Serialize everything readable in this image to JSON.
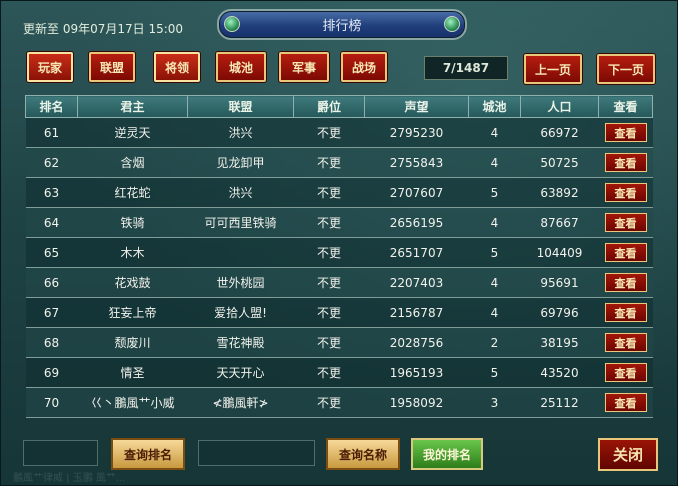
{
  "header": {
    "updated_text": "更新至 09年07月17日 15:00",
    "title": "排行榜"
  },
  "tabs": [
    {
      "label": "玩家",
      "active": true
    },
    {
      "label": "联盟",
      "active": false
    },
    {
      "label": "将领",
      "active": true
    },
    {
      "label": "城池",
      "active": false
    },
    {
      "label": "军事",
      "active": false
    },
    {
      "label": "战场",
      "active": false
    }
  ],
  "pager": {
    "counter": "7/1487",
    "prev_label": "上一页",
    "next_label": "下一页"
  },
  "table": {
    "columns": [
      "排名",
      "君主",
      "联盟",
      "爵位",
      "声望",
      "城池",
      "人口",
      "查看"
    ],
    "view_label": "查看",
    "rows": [
      {
        "rank": "61",
        "lord": "逆灵天",
        "alliance": "洪兴",
        "title": "不更",
        "prestige": "2795230",
        "cities": "4",
        "population": "66972"
      },
      {
        "rank": "62",
        "lord": "含烟",
        "alliance": "见龙卸甲",
        "title": "不更",
        "prestige": "2755843",
        "cities": "4",
        "population": "50725"
      },
      {
        "rank": "63",
        "lord": "红花蛇",
        "alliance": "洪兴",
        "title": "不更",
        "prestige": "2707607",
        "cities": "5",
        "population": "63892"
      },
      {
        "rank": "64",
        "lord": "铁骑",
        "alliance": "可可西里铁骑",
        "title": "不更",
        "prestige": "2656195",
        "cities": "4",
        "population": "87667"
      },
      {
        "rank": "65",
        "lord": "木木",
        "alliance": "",
        "title": "不更",
        "prestige": "2651707",
        "cities": "5",
        "population": "104409"
      },
      {
        "rank": "66",
        "lord": "花戏鼓",
        "alliance": "世外桃园",
        "title": "不更",
        "prestige": "2207403",
        "cities": "4",
        "population": "95691"
      },
      {
        "rank": "67",
        "lord": "狂妄上帝",
        "alliance": "爱拾人盟!",
        "title": "不更",
        "prestige": "2156787",
        "cities": "4",
        "population": "69796"
      },
      {
        "rank": "68",
        "lord": "颓废川",
        "alliance": "雪花神殿",
        "title": "不更",
        "prestige": "2028756",
        "cities": "2",
        "population": "38195"
      },
      {
        "rank": "69",
        "lord": "情圣",
        "alliance": "天天开心",
        "title": "不更",
        "prestige": "1965193",
        "cities": "5",
        "population": "43520"
      },
      {
        "rank": "70",
        "lord": "巜丶鵬風艹小威",
        "alliance": "≮鵬風軒≯",
        "title": "不更",
        "prestige": "1958092",
        "cities": "3",
        "population": "25112"
      }
    ]
  },
  "footer": {
    "rank_input_value": "",
    "query_rank_label": "查询排名",
    "name_input_value": "",
    "query_name_label": "查询名称",
    "my_rank_label": "我的排名",
    "close_label": "关闭"
  },
  "background_text": "鵬風艹律威 | 玉鵬 風艹..."
}
